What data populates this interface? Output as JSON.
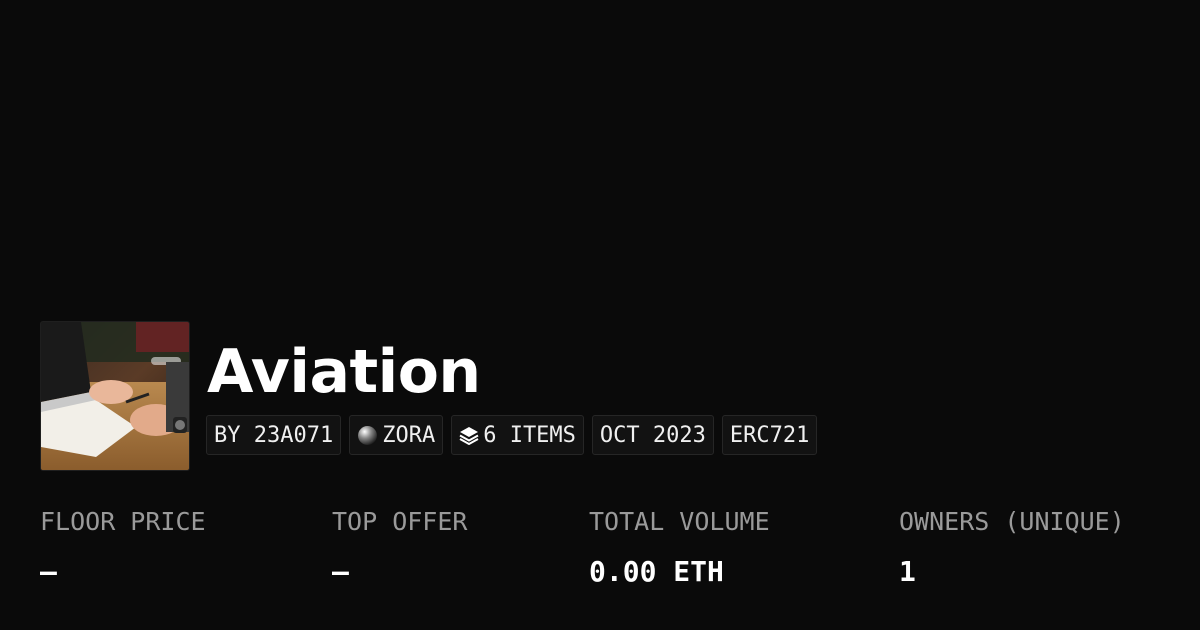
{
  "collection": {
    "name": "Aviation",
    "thumbnail_icon": "collection-image"
  },
  "badges": {
    "creator": "BY 23A071",
    "network_icon": "zora-orb-icon",
    "network": "ZORA",
    "items_icon": "layers-icon",
    "items": "6 ITEMS",
    "date": "OCT 2023",
    "standard": "ERC721"
  },
  "stats": {
    "floor_price": {
      "label": "FLOOR PRICE",
      "value": "–"
    },
    "top_offer": {
      "label": "TOP OFFER",
      "value": "–"
    },
    "total_volume": {
      "label": "TOTAL VOLUME",
      "value": "0.00 ETH"
    },
    "owners": {
      "label": "OWNERS (UNIQUE)",
      "value": "1"
    }
  },
  "colors": {
    "background": "#0a0a0a",
    "text": "#ffffff",
    "muted_text": "#9a9a9a",
    "badge_bg": "#121212",
    "badge_border": "#262626"
  }
}
